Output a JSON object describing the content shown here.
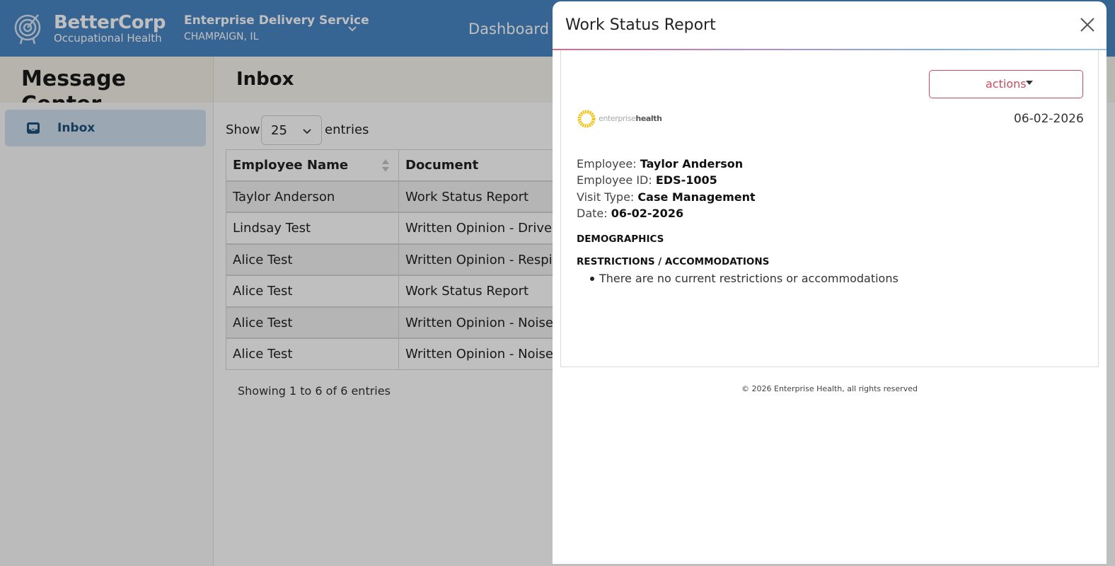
{
  "header": {
    "brand_name": "BetterCorp",
    "brand_sub": "Occupational Health",
    "company_name": "Enterprise Delivery Service",
    "company_location": "CHAMPAIGN, IL",
    "nav_dashboard": "Dashboard"
  },
  "left_panel": {
    "title": "Message Center",
    "items": [
      {
        "label": "Inbox",
        "icon": "inbox-icon"
      }
    ]
  },
  "main": {
    "title": "Inbox",
    "show_label": "Show",
    "page_size": "25",
    "entries_label": "entries",
    "columns": [
      "Employee Name",
      "Document"
    ],
    "rows": [
      {
        "employee": "Taylor Anderson",
        "document": "Work Status Report"
      },
      {
        "employee": "Lindsay Test",
        "document": "Written Opinion - Driver Fitness"
      },
      {
        "employee": "Alice Test",
        "document": "Written Opinion - Respirator"
      },
      {
        "employee": "Alice Test",
        "document": "Work Status Report"
      },
      {
        "employee": "Alice Test",
        "document": "Written Opinion - Noise"
      },
      {
        "employee": "Alice Test",
        "document": "Written Opinion - Noise"
      }
    ],
    "showing_info": "Showing 1 to 6 of 6 entries"
  },
  "drawer": {
    "title": "Work Status Report",
    "actions_label": "actions",
    "logo_text_light": "enterprise",
    "logo_text_bold": "health",
    "date": "06-02-2026",
    "fields": [
      {
        "label": "Employee:",
        "value": "Taylor Anderson"
      },
      {
        "label": "Employee ID:",
        "value": "EDS-1005"
      },
      {
        "label": "Visit Type:",
        "value": "Case Management"
      },
      {
        "label": "Date:",
        "value": "06-02-2026"
      }
    ],
    "demographics_heading": "DEMOGRAPHICS",
    "restrictions_heading": "RESTRICTIONS / ACCOMMODATIONS",
    "restrictions_items": [
      "There are no current restrictions or accommodations"
    ],
    "copyright": "© 2026 Enterprise Health, all rights reserved"
  },
  "colors": {
    "topbar": "#4a87c5",
    "accent_red": "#c94b5e",
    "sidebar_active": "#cfe0ef"
  }
}
